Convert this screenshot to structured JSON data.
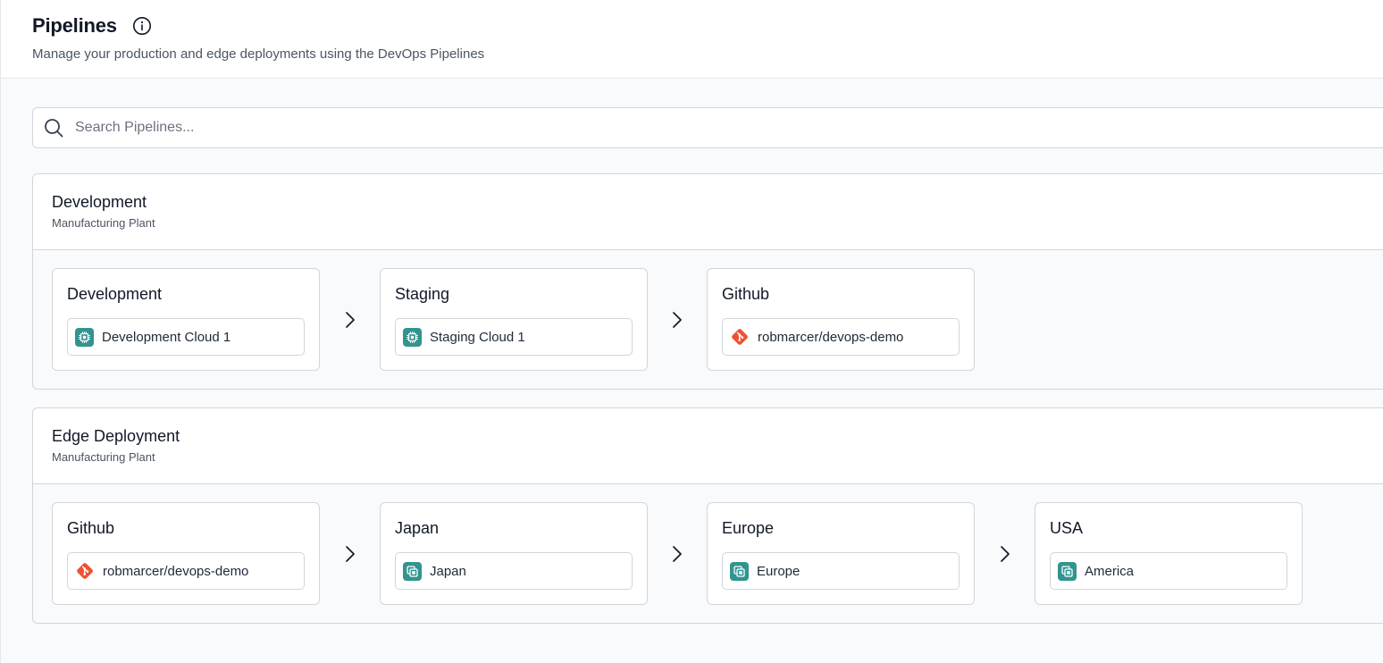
{
  "header": {
    "title": "Pipelines",
    "subtitle": "Manage your production and edge deployments using the DevOps Pipelines"
  },
  "search": {
    "placeholder": "Search Pipelines...",
    "value": ""
  },
  "colors": {
    "instance_icon": "#31948f",
    "git_icon": "#f05133",
    "border": "#d1d5db"
  },
  "pipelines": [
    {
      "name": "Development",
      "application": "Manufacturing Plant",
      "stages": [
        {
          "name": "Development",
          "target": "Development Cloud 1",
          "icon": "instance-icon"
        },
        {
          "name": "Staging",
          "target": "Staging Cloud 1",
          "icon": "instance-icon"
        },
        {
          "name": "Github",
          "target": "robmarcer/devops-demo",
          "icon": "git-icon"
        }
      ]
    },
    {
      "name": "Edge Deployment",
      "application": "Manufacturing Plant",
      "stages": [
        {
          "name": "Github",
          "target": "robmarcer/devops-demo",
          "icon": "git-icon"
        },
        {
          "name": "Japan",
          "target": "Japan",
          "icon": "device-group-icon"
        },
        {
          "name": "Europe",
          "target": "Europe",
          "icon": "device-group-icon"
        },
        {
          "name": "USA",
          "target": "America",
          "icon": "device-group-icon"
        }
      ]
    }
  ]
}
